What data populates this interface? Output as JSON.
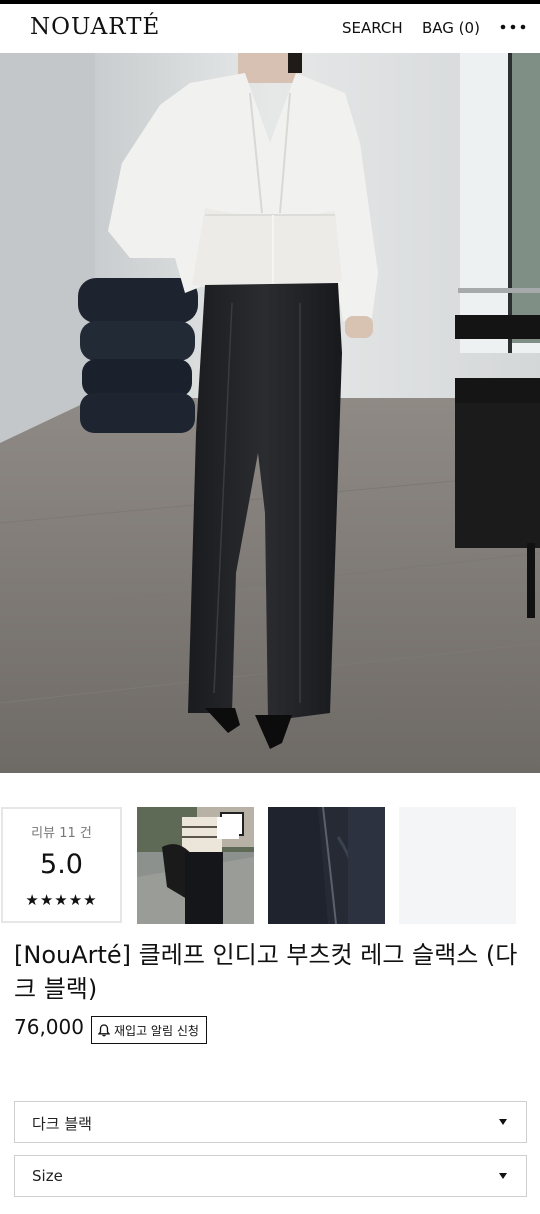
{
  "header": {
    "logo": "NOUARTÉ",
    "search_label": "SEARCH",
    "bag_label": "BAG (0)",
    "more_icon": "more-horizontal-icon"
  },
  "hero": {
    "image": "product-model-photo"
  },
  "review": {
    "label": "리뷰 11 건",
    "score": "5.0",
    "stars": "★★★★★"
  },
  "thumbnails": [
    {
      "name": "street-style-photo"
    },
    {
      "name": "fabric-detail-photo"
    },
    {
      "name": "blank-placeholder"
    }
  ],
  "product": {
    "title": "[NouArté] 클레프 인디고 부츠컷 레그 슬랙스 (다크 블랙)",
    "price": "76,000",
    "restock_label": "재입고 알림 신청",
    "restock_icon": "bell-icon"
  },
  "options": {
    "color_value": "다크 블랙",
    "size_placeholder": "Size",
    "arrow_icon": "caret-down-icon"
  }
}
